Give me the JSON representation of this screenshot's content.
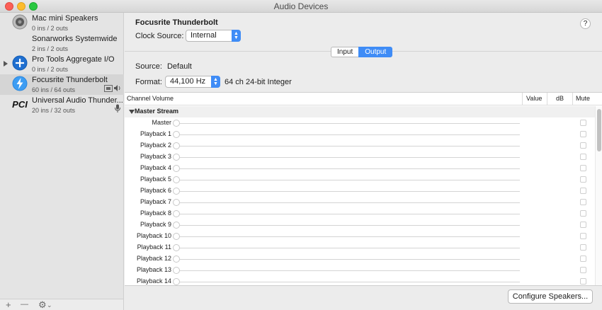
{
  "window": {
    "title": "Audio Devices"
  },
  "devices": [
    {
      "name": "Mac mini Speakers",
      "sub": "0 ins / 2 outs",
      "icon": "speaker-icon"
    },
    {
      "name": "Sonarworks Systemwide",
      "sub": "2 ins / 2 outs",
      "icon": "none"
    },
    {
      "name": "Pro Tools Aggregate I/O",
      "sub": "0 ins / 2 outs",
      "icon": "aggregate-plus-icon"
    },
    {
      "name": "Focusrite Thunderbolt",
      "sub": "60 ins / 64 outs",
      "icon": "thunderbolt-icon"
    },
    {
      "name": "Universal Audio Thunder...",
      "sub": "20 ins / 32 outs",
      "icon": "pci-icon",
      "icon_text": "PCI"
    }
  ],
  "sidebar_footer": {
    "add": "+",
    "remove": "—",
    "gear": "⚙",
    "gear_caret": "⌄"
  },
  "main": {
    "device_title": "Focusrite Thunderbolt",
    "clock_label": "Clock Source:",
    "clock_value": "Internal",
    "help": "?",
    "tabs": {
      "input": "Input",
      "output": "Output",
      "active": "output"
    },
    "source_label": "Source:",
    "source_value": "Default",
    "format_label": "Format:",
    "format_value": "44,100 Hz",
    "format_extra": "64 ch 24-bit Integer",
    "columns": {
      "channel_volume": "Channel Volume",
      "value": "Value",
      "db": "dB",
      "mute": "Mute"
    },
    "group": "Master Stream",
    "channels": [
      "Master",
      "Playback 1",
      "Playback 2",
      "Playback 3",
      "Playback 4",
      "Playback 5",
      "Playback 6",
      "Playback 7",
      "Playback 8",
      "Playback 9",
      "Playback 10",
      "Playback 11",
      "Playback 12",
      "Playback 13",
      "Playback 14"
    ],
    "configure_button": "Configure Speakers..."
  },
  "colors": {
    "accent": "#3f8cf6",
    "selection": "#d5d5d5"
  }
}
